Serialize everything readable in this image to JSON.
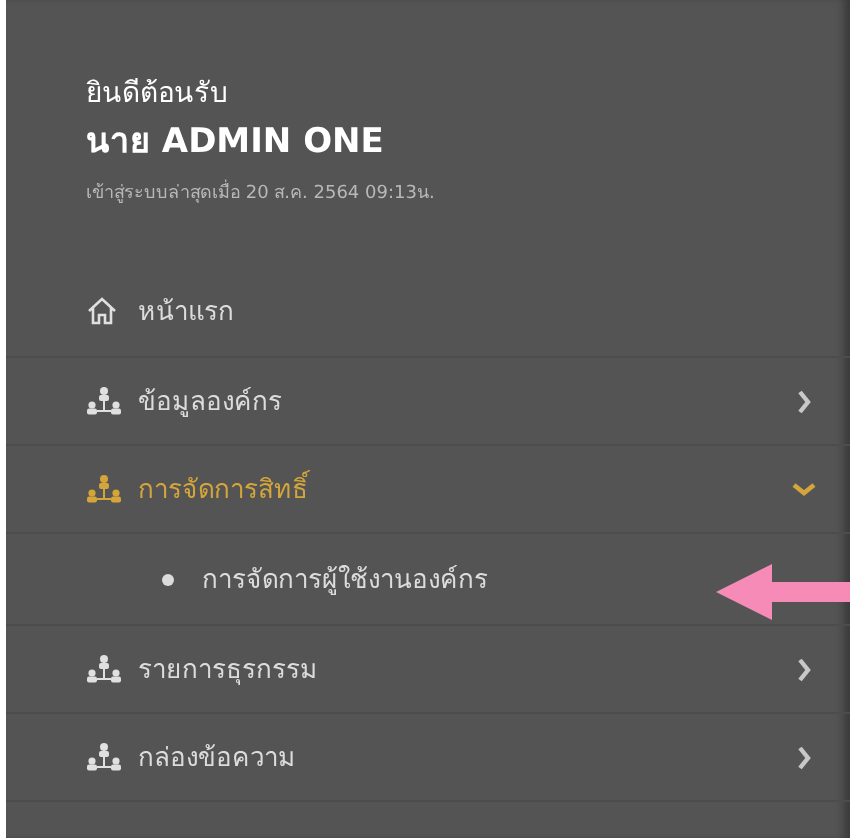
{
  "header": {
    "welcome": "ยินดีต้อนรับ",
    "user_name": "นาย ADMIN ONE",
    "last_login": "เข้าสู่ระบบล่าสุดเมื่อ 20 ส.ค. 2564 09:13น."
  },
  "menu": [
    {
      "kind": "home",
      "label": "หน้าแรก",
      "selected": false
    },
    {
      "kind": "group",
      "label": "ข้อมูลองค์กร",
      "selected": false,
      "expanded": false
    },
    {
      "kind": "group",
      "label": "การจัดการสิทธิ์",
      "selected": true,
      "expanded": true,
      "children": [
        {
          "label": "การจัดการผู้ใช้งานองค์กร",
          "selected": false
        }
      ]
    },
    {
      "kind": "group",
      "label": "รายการธุรกรรม",
      "selected": false,
      "expanded": false
    },
    {
      "kind": "group",
      "label": "กล่องข้อความ",
      "selected": false,
      "expanded": false
    }
  ]
}
